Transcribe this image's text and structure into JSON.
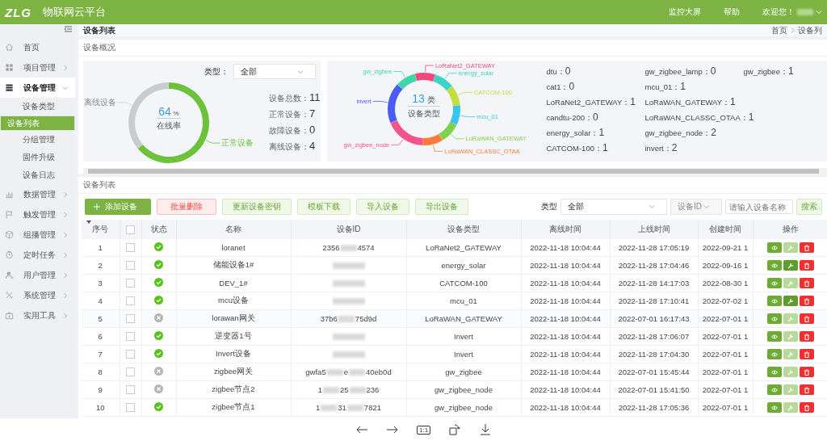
{
  "header": {
    "logo": "ZLG",
    "title": "物联网云平台",
    "links": [
      "监控大屏",
      "帮助"
    ],
    "welcome": "欢迎您！"
  },
  "sidebar": {
    "items": [
      {
        "label": "首页",
        "kind": "page"
      },
      {
        "label": "项目管理",
        "kind": "group",
        "expanded": false
      },
      {
        "label": "设备管理",
        "kind": "group",
        "expanded": true,
        "children": [
          {
            "label": "设备类型",
            "selected": false
          },
          {
            "label": "设备列表",
            "selected": true
          },
          {
            "label": "分组管理",
            "selected": false
          },
          {
            "label": "固件升级",
            "selected": false
          },
          {
            "label": "设备日志",
            "selected": false
          }
        ]
      },
      {
        "label": "数据管理",
        "kind": "group",
        "expanded": false
      },
      {
        "label": "触发管理",
        "kind": "group",
        "expanded": false
      },
      {
        "label": "组播管理",
        "kind": "group",
        "expanded": false
      },
      {
        "label": "定时任务",
        "kind": "group",
        "expanded": false
      },
      {
        "label": "用户管理",
        "kind": "group",
        "expanded": false
      },
      {
        "label": "系统管理",
        "kind": "group",
        "expanded": false
      },
      {
        "label": "实用工具",
        "kind": "group",
        "expanded": false
      }
    ]
  },
  "breadcrumb": {
    "title": "设备列表",
    "trail": [
      "首页",
      "设备列"
    ]
  },
  "overview": {
    "title": "设备概况",
    "type_label": "类型：",
    "type_value": "全部",
    "rate": "64",
    "rate_unit": "%",
    "rate_caption": "在线率",
    "chart_data": {
      "type": "donut",
      "categories": [
        "离线设备",
        "正常设备"
      ],
      "values": [
        36,
        64
      ],
      "colors": [
        "#c8cbd0",
        "#6cc23a"
      ]
    },
    "stats": [
      {
        "label": "设备总数：",
        "value": "11"
      },
      {
        "label": "正常设备：",
        "value": "7"
      },
      {
        "label": "故障设备：",
        "value": "0"
      },
      {
        "label": "离线设备：",
        "value": "4"
      }
    ],
    "types": {
      "center": "13",
      "unit": "类",
      "caption": "设备类型",
      "chart_data": {
        "type": "donut",
        "categories": [
          "LoRaNet2_GATEWAY",
          "energy_solar",
          "CATCOM-100",
          "mcu_01",
          "LoRaWAN_GATEWAY",
          "LoRaWAN_CLASSC_OTAA",
          "gw_zigbee_node",
          "invert",
          "gw_zigbee"
        ],
        "values": [
          1,
          1,
          1,
          1,
          1,
          1,
          2,
          2,
          1
        ],
        "colors": [
          "#f0487a",
          "#3fd3c4",
          "#c5dd3a",
          "#38c6ee",
          "#7fd14a",
          "#ff7a3a",
          "#f5538c",
          "#4b5cf2",
          "#3fd6ae"
        ]
      }
    },
    "type_counts": [
      {
        "label": "dtu：",
        "value": "0"
      },
      {
        "label": "cat1：",
        "value": "0"
      },
      {
        "label": "LoRaNet2_GATEWAY：",
        "value": "1"
      },
      {
        "label": "candtu-200：",
        "value": "0"
      },
      {
        "label": "energy_solar：",
        "value": "1"
      },
      {
        "label": "CATCOM-100：",
        "value": "1"
      },
      {
        "label": "gw_zigbee_lamp：",
        "value": "0"
      },
      {
        "label": "mcu_01：",
        "value": "1"
      },
      {
        "label": "LoRaWAN_GATEWAY：",
        "value": "1"
      },
      {
        "label": "LoRaWAN_CLASSC_OTAA：",
        "value": "1"
      },
      {
        "label": "gw_zigbee_node：",
        "value": "2"
      },
      {
        "label": "invert：",
        "value": "2"
      },
      {
        "label": "gw_zigbee：",
        "value": "1"
      }
    ]
  },
  "list": {
    "title": "设备列表",
    "buttons": [
      {
        "label": "添加设备",
        "kind": "primary"
      },
      {
        "label": "批量删除",
        "kind": "danger"
      },
      {
        "label": "更新设备密钥",
        "kind": "plain"
      },
      {
        "label": "模板下载",
        "kind": "plain"
      },
      {
        "label": "导入设备",
        "kind": "plain"
      },
      {
        "label": "导出设备",
        "kind": "plain"
      }
    ],
    "filter": {
      "type_label": "类型",
      "type_value": "全部",
      "field_select": "设备ID",
      "placeholder": "请输入设备名称",
      "search": "搜索"
    },
    "select_all_checked": false,
    "columns": [
      "序号",
      "状态",
      "名称",
      "设备ID",
      "设备类型",
      "离线时间",
      "上线时间",
      "创建时间",
      "操作"
    ],
    "rows": [
      {
        "no": "1",
        "checked": false,
        "online": true,
        "name": "loranet",
        "id_parts": [
          "2356",
          "4574"
        ],
        "type": "LoRaNet2_GATEWAY",
        "offline": "2022-11-18 10:04:44",
        "online_time": "2022-11-28 17:05:19",
        "created": "2022-09-21 1",
        "edit_enabled": false
      },
      {
        "no": "2",
        "checked": false,
        "online": true,
        "name": "储能设备1#",
        "type": "energy_solar",
        "offline": "2022-11-18 10:04:44",
        "online_time": "2022-11-28 17:04:46",
        "created": "2022-09-16 1",
        "edit_enabled": true
      },
      {
        "no": "3",
        "checked": false,
        "online": true,
        "name": "DEV_1#",
        "type": "CATCOM-100",
        "offline": "2022-11-18 10:04:44",
        "online_time": "2022-11-28 14:17:03",
        "created": "2022-08-30 1",
        "edit_enabled": false
      },
      {
        "no": "4",
        "checked": false,
        "online": true,
        "name": "mcu设备",
        "type": "mcu_01",
        "offline": "2022-11-18 10:04:44",
        "online_time": "2022-11-28 17:10:41",
        "created": "2022-07-02 1",
        "edit_enabled": true
      },
      {
        "no": "5",
        "checked": false,
        "online": false,
        "name": "lorawan网关",
        "id_parts": [
          "37b6",
          "75d9d"
        ],
        "type": "LoRaWAN_GATEWAY",
        "offline": "2022-11-18 10:04:44",
        "online_time": "2022-07-01 16:17:43",
        "created": "2022-07-01 1",
        "edit_enabled": false
      },
      {
        "no": "6",
        "checked": false,
        "online": true,
        "name": "逆变器1号",
        "type": "Invert",
        "offline": "2022-11-18 10:04:44",
        "online_time": "2022-11-28 17:06:07",
        "created": "2022-07-01 1",
        "edit_enabled": false
      },
      {
        "no": "7",
        "checked": false,
        "online": true,
        "name": "Invert设备",
        "type": "Invert",
        "offline": "2022-11-18 10:04:44",
        "online_time": "2022-11-28 17:04:30",
        "created": "2022-07-01 1",
        "edit_enabled": false
      },
      {
        "no": "8",
        "checked": false,
        "online": false,
        "name": "zigbee网关",
        "id_parts": [
          "gwfa5",
          "e",
          "40eb0d"
        ],
        "type": "gw_zigbee",
        "offline": "2022-11-18 10:04:44",
        "online_time": "2022-07-01 15:45:44",
        "created": "2022-07-01 1",
        "edit_enabled": false
      },
      {
        "no": "9",
        "checked": false,
        "online": false,
        "name": "zigbee节点2",
        "id_parts": [
          "1",
          "25",
          "236"
        ],
        "type": "gw_zigbee_node",
        "offline": "2022-11-18 10:04:44",
        "online_time": "2022-07-01 15:41:50",
        "created": "2022-07-01 1",
        "edit_enabled": false
      },
      {
        "no": "10",
        "checked": false,
        "online": true,
        "name": "zigbee节点1",
        "id_parts": [
          "1",
          "31",
          "7821"
        ],
        "type": "gw_zigbee_node",
        "offline": "2022-11-18 10:04:44",
        "online_time": "2022-11-28 17:05:36",
        "created": "2022-07-01 1",
        "edit_enabled": false
      }
    ]
  },
  "viewer": {
    "zoom_label": "1:1"
  }
}
